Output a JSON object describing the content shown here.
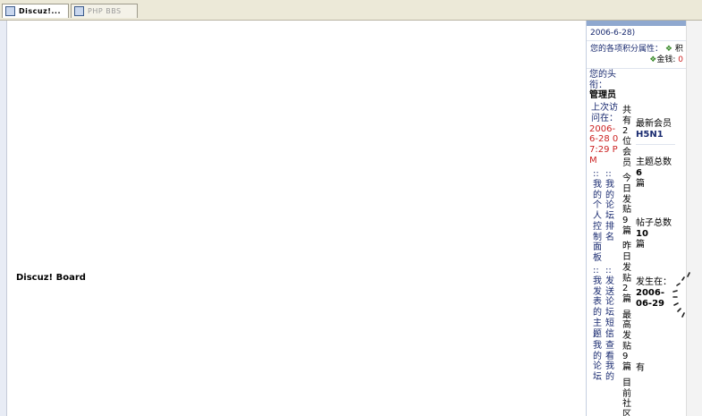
{
  "tabs": [
    {
      "label": "Discuz!..."
    },
    {
      "label": "PHP BBS"
    }
  ],
  "board": {
    "title": "Discuz! Board"
  },
  "right": {
    "date_suffix": "2006-6-28)",
    "points_label": "您的各项积分属性：",
    "points_more": "积",
    "gold_label": "金钱:",
    "gold_value": "0",
    "title_label": "您的头衔：",
    "title_value": "管理员",
    "last_visit_label": "上次访问在：",
    "last_visit_value": "2006-6-28 07:29 PM",
    "link_panel": ":: 我的个人控制面板",
    "link_topics": ":: 我发表的主题",
    "link_mine": ":: 我的论坛",
    "link_rank": ":: 我的论坛排名",
    "link_pm": ":: 发送论坛短信",
    "link_view": ":: 查看我的",
    "stats_members": "共有2位会员",
    "stats_today": "今日发贴9篇",
    "stats_yesterday": "昨日发贴2篇",
    "stats_max": "最高发贴9篇",
    "stats_online": "目前社区",
    "newest_label": "最新会员",
    "newest_value": "H5N1",
    "topics_label": "主题总数",
    "topics_value": "6",
    "topics_unit": "篇",
    "posts_label": "帖子总数",
    "posts_value": "10",
    "posts_unit": "篇",
    "occurred_label": "发生在：",
    "occurred_value": "2006-06-29",
    "tail": "有"
  },
  "colors": {
    "accent": "#8fa8cf",
    "link": "#1a2b70",
    "highlight": "#c22"
  }
}
